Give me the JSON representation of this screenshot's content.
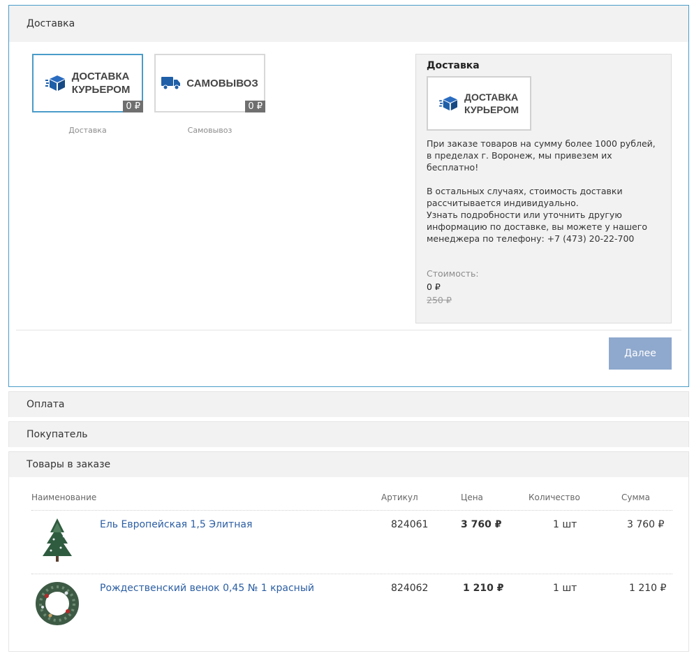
{
  "delivery": {
    "title": "Доставка",
    "options": [
      {
        "logo_line1": "Доставка",
        "logo_line2": "курьером",
        "price": "0 ₽",
        "label": "Доставка",
        "selected": true
      },
      {
        "logo_line1": "Самовывоз",
        "logo_line2": "",
        "price": "0 ₽",
        "label": "Самовывоз",
        "selected": false
      }
    ],
    "info": {
      "title": "Доставка",
      "logo_line1": "Доставка",
      "logo_line2": "курьером",
      "paragraph1": "При заказе товаров на сумму более 1000 рублей, в пределах г. Воронеж, мы привезем их бесплатно!",
      "paragraph2a": "В остальных случаях, стоимость доставки рассчитывается индивидуально.",
      "paragraph2b": "Узнать подробности или уточнить другую информацию по доставке, вы можете у нашего менеджера по телефону: +7 (473) 20-22-700",
      "cost_label": "Стоимость:",
      "cost": "0 ₽",
      "old_cost": "250 ₽"
    },
    "next_button": "Далее"
  },
  "payment": {
    "title": "Оплата"
  },
  "buyer": {
    "title": "Покупатель"
  },
  "goods": {
    "title": "Товары в заказе",
    "columns": {
      "name": "Наименование",
      "article": "Артикул",
      "price": "Цена",
      "qty": "Количество",
      "sum": "Сумма"
    },
    "items": [
      {
        "name": "Ель Европейская 1,5 Элитная",
        "article": "824061",
        "price": "3 760 ₽",
        "qty": "1 шт",
        "sum": "3 760 ₽",
        "thumb": "fir-tree-image"
      },
      {
        "name": "Рождественский венок 0,45 № 1 красный",
        "article": "824062",
        "price": "1 210 ₽",
        "qty": "1 шт",
        "sum": "1 210 ₽",
        "thumb": "wreath-image"
      }
    ]
  },
  "colors": {
    "accent": "#4a9cc9",
    "button": "#8fa8cd",
    "link": "#2b5ea3",
    "icon": "#1f5fa8"
  }
}
